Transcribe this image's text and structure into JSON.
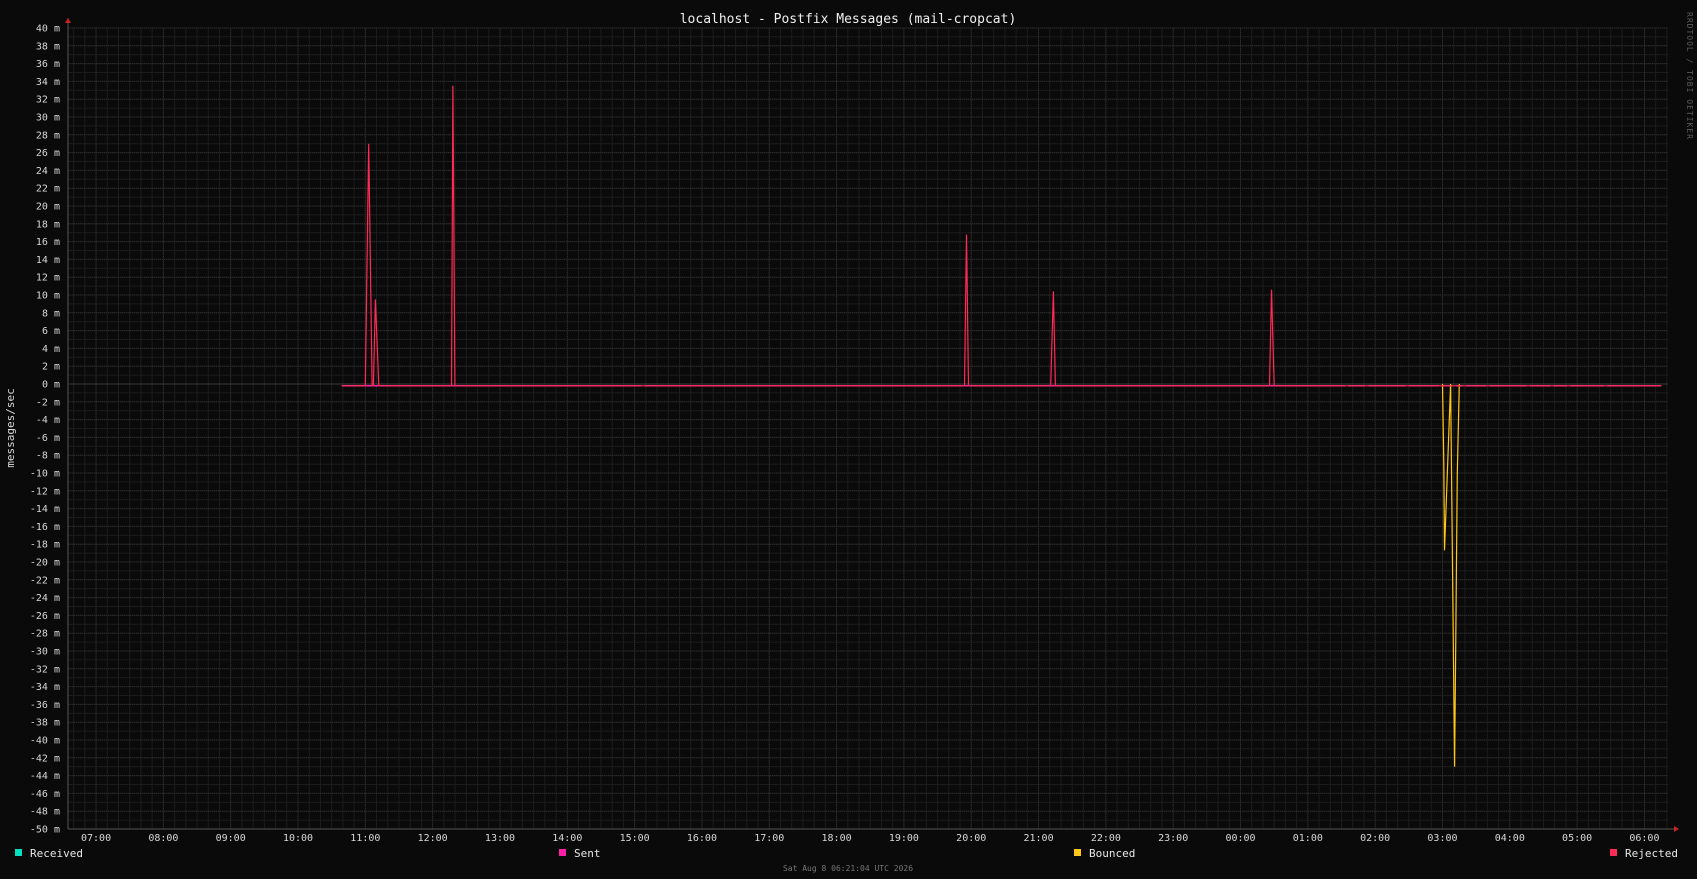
{
  "chart_data": {
    "type": "line",
    "title": "localhost - Postfix Messages (mail-cropcat)",
    "ylabel": "messages/sec",
    "ylim": [
      -50,
      40
    ],
    "y_unit": "m",
    "y_ticks": [
      40,
      38,
      36,
      34,
      32,
      30,
      28,
      26,
      24,
      22,
      20,
      18,
      16,
      14,
      12,
      10,
      8,
      6,
      4,
      2,
      0,
      -2,
      -4,
      -6,
      -8,
      -10,
      -12,
      -14,
      -16,
      -18,
      -20,
      -22,
      -24,
      -26,
      -28,
      -30,
      -32,
      -34,
      -36,
      -38,
      -40,
      -42,
      -44,
      -46,
      -48,
      -50
    ],
    "x_ticks": [
      "07:00",
      "08:00",
      "09:00",
      "10:00",
      "11:00",
      "12:00",
      "13:00",
      "14:00",
      "15:00",
      "16:00",
      "17:00",
      "18:00",
      "19:00",
      "20:00",
      "21:00",
      "22:00",
      "23:00",
      "00:00",
      "01:00",
      "02:00",
      "03:00",
      "04:00",
      "05:00",
      "06:00"
    ],
    "grid": true,
    "legend_position": "bottom",
    "series": [
      {
        "name": "Received",
        "color": "#00e0c0",
        "points": []
      },
      {
        "name": "Sent",
        "color": "#ff1eaa",
        "points": [
          [
            10.65,
            -0.2
          ],
          [
            30.25,
            -0.2
          ]
        ],
        "gaps": [
          [
            15.1,
            15.15
          ],
          [
            25.55,
            25.6
          ],
          [
            25.85,
            25.9
          ],
          [
            26.45,
            26.5
          ],
          [
            26.95,
            27.0
          ],
          [
            27.15,
            27.2
          ],
          [
            27.3,
            27.35
          ],
          [
            27.65,
            27.7
          ],
          [
            28.25,
            28.3
          ],
          [
            28.6,
            28.65
          ],
          [
            28.85,
            28.9
          ],
          [
            29.4,
            29.45
          ]
        ]
      },
      {
        "name": "Bounced",
        "color": "#ffc61a",
        "points": [
          [
            27.0,
            0
          ],
          [
            27.02,
            -9
          ],
          [
            27.03,
            -18.7
          ],
          [
            27.12,
            0
          ],
          [
            27.18,
            -43
          ],
          [
            27.22,
            -10
          ],
          [
            27.25,
            0
          ]
        ]
      },
      {
        "name": "Rejected",
        "color": "#ff2a55",
        "points": [
          [
            10.65,
            -0.2
          ],
          [
            11.0,
            -0.2
          ],
          [
            11.05,
            27
          ],
          [
            11.1,
            -0.2
          ],
          [
            11.12,
            -0.2
          ],
          [
            11.15,
            9.5
          ],
          [
            11.2,
            -0.2
          ],
          [
            12.28,
            -0.2
          ],
          [
            12.3,
            33.5
          ],
          [
            12.33,
            -0.2
          ],
          [
            19.9,
            -0.2
          ],
          [
            19.93,
            16.8
          ],
          [
            19.96,
            -0.2
          ],
          [
            21.18,
            -0.2
          ],
          [
            21.22,
            10.4
          ],
          [
            21.25,
            -0.2
          ],
          [
            24.43,
            -0.2
          ],
          [
            24.46,
            10.6
          ],
          [
            24.5,
            -0.2
          ],
          [
            30.25,
            -0.2
          ]
        ]
      }
    ]
  },
  "watermark": "RRDTOOL / TOBI OETIKER",
  "timestamp": "Sat Aug  8 06:21:04 UTC 2026"
}
